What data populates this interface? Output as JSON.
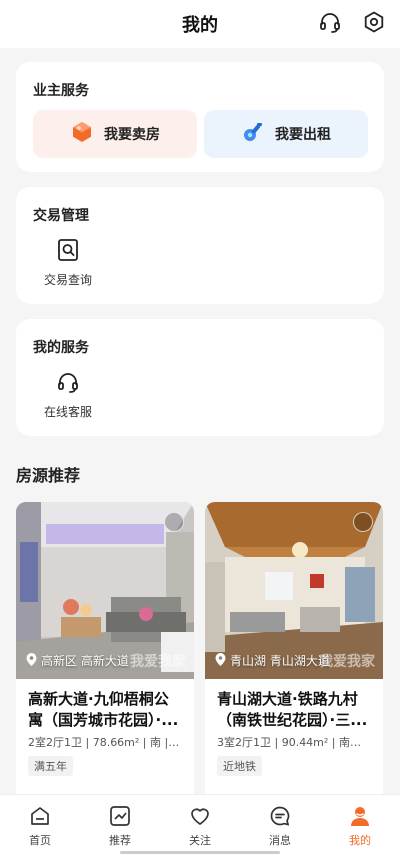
{
  "header": {
    "title": "我的",
    "icons": [
      "headset-icon",
      "settings-icon"
    ]
  },
  "owner_service": {
    "title": "业主服务",
    "sell_label": "我要卖房",
    "rent_label": "我要出租"
  },
  "trade": {
    "title": "交易管理",
    "query_label": "交易查询"
  },
  "my_service": {
    "title": "我的服务",
    "support_label": "在线客服"
  },
  "recommend": {
    "title": "房源推荐",
    "listings": [
      {
        "location": "高新区 高新大道",
        "title": "高新大道·九仰梧桐公寓（国芳城市花园）·...",
        "info": "2室2厅1卫 | 78.66m² | 南 | ...",
        "tag": "满五年"
      },
      {
        "location": "青山湖 青山湖大道",
        "title": "青山湖大道·铁路九村（南铁世纪花园）·三...",
        "info": "3室2厅1卫 | 90.44m² | 南北 | ...",
        "tag": "近地铁"
      }
    ],
    "watermark": "我爱我家"
  },
  "tabs": [
    {
      "label": "首页",
      "icon": "home-icon"
    },
    {
      "label": "推荐",
      "icon": "trend-icon"
    },
    {
      "label": "关注",
      "icon": "heart-icon"
    },
    {
      "label": "消息",
      "icon": "message-icon"
    },
    {
      "label": "我的",
      "icon": "profile-icon",
      "active": true
    }
  ],
  "colors": {
    "accent": "#f26b2b",
    "sell_bg": "#fdf0ec",
    "rent_bg": "#ebf3fd"
  }
}
